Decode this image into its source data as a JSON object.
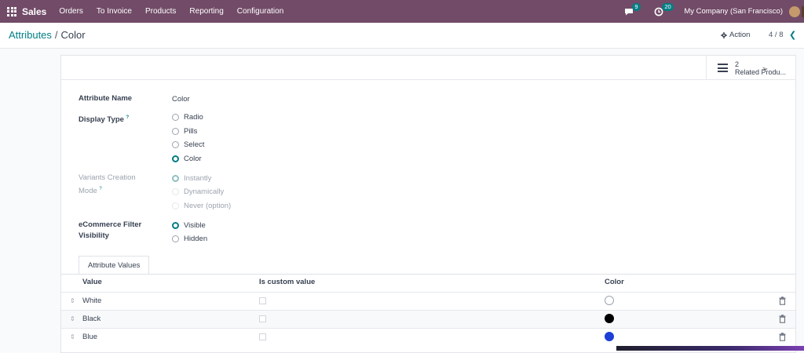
{
  "app": {
    "name": "Sales"
  },
  "nav": {
    "menu": [
      "Orders",
      "To Invoice",
      "Products",
      "Reporting",
      "Configuration"
    ],
    "messages_count": "9",
    "activities_count": "20",
    "company": "My Company (San Francisco)"
  },
  "breadcrumb": {
    "parent": "Attributes",
    "separator": "/",
    "current": "Color"
  },
  "control": {
    "action_label": "Action",
    "pager": "4 / 8"
  },
  "smart_button": {
    "count": "2",
    "label": "Related Produ..."
  },
  "form": {
    "attribute_name_label": "Attribute Name",
    "attribute_name_value": "Color",
    "display_type_label": "Display Type",
    "help_marker": "?",
    "display_type_options": [
      "Radio",
      "Pills",
      "Select",
      "Color"
    ],
    "display_type_selected": "Color",
    "variants_label_line1": "Variants Creation",
    "variants_label_line2": "Mode",
    "variants_options": [
      "Instantly",
      "Dynamically",
      "Never (option)"
    ],
    "variants_selected": "Instantly",
    "ecommerce_label_line1": "eCommerce Filter",
    "ecommerce_label_line2": "Visibility",
    "ecommerce_options": [
      "Visible",
      "Hidden"
    ],
    "ecommerce_selected": "Visible"
  },
  "notebook": {
    "tab_label": "Attribute Values",
    "columns": [
      "Value",
      "Is custom value",
      "Color"
    ],
    "rows": [
      {
        "value": "White",
        "custom": false,
        "color": "#ffffff"
      },
      {
        "value": "Black",
        "custom": false,
        "color": "#000000"
      },
      {
        "value": "Blue",
        "custom": false,
        "color": "#1d3fd6"
      }
    ]
  },
  "colors": {
    "brand": "#714b67",
    "accent": "#017e84"
  },
  "icons": {
    "apps": "apps-grid-icon",
    "messages": "chat-bubble-icon",
    "activities": "clock-icon",
    "action": "gear-icon",
    "pager_prev": "chevron-left-icon",
    "smart_button": "list-icon",
    "row_handle": "drag-handle-icon",
    "row_delete": "trash-icon"
  }
}
